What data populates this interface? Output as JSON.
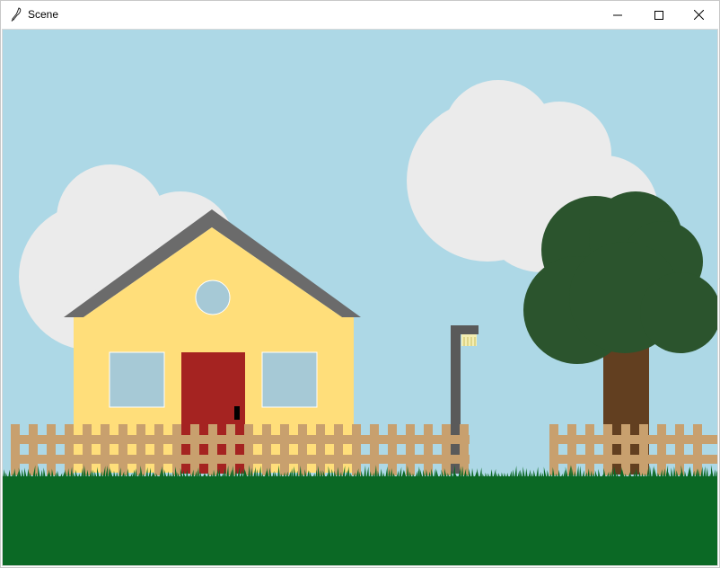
{
  "window": {
    "title": "Scene",
    "icon": "feather-icon",
    "controls": [
      "minimize-icon",
      "maximize-icon",
      "close-icon"
    ]
  },
  "scene": {
    "colors": {
      "sky": "#add8e6",
      "cloud": "#ebebeb",
      "house_wall": "#ffde7a",
      "roof": "#6b6b6b",
      "door": "#a52321",
      "door_handle": "#000000",
      "window_glass": "#a6c9d6",
      "fence": "#c8a06e",
      "lamp_post": "#5a5a5a",
      "lamp_light": "#f4eeb2",
      "trunk": "#623f20",
      "foliage": "#2b542d",
      "grass": "#0b6925"
    }
  }
}
